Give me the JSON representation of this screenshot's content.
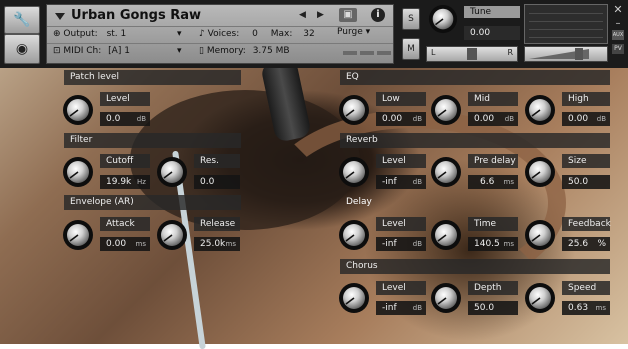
{
  "header": {
    "title": "Urban Gongs Raw",
    "output_label": "Output:",
    "output_value": "st. 1",
    "voices_label": "Voices:",
    "voices_value": "0",
    "max_label": "Max:",
    "max_value": "32",
    "midi_label": "MIDI Ch:",
    "midi_value": "[A]  1",
    "memory_label": "Memory:",
    "memory_value": "3.75 MB",
    "purge_label": "Purge",
    "solo_label": "S",
    "mute_label": "M",
    "tune_label": "Tune",
    "tune_value": "0.00",
    "pan_left": "L",
    "pan_right": "R",
    "aux_label": "AUX",
    "pv_label": "PV"
  },
  "patch_level": {
    "section": "Patch level",
    "label": "Level",
    "value": "0.0",
    "unit": "dB"
  },
  "filter": {
    "section": "Filter",
    "cutoff_label": "Cutoff",
    "cutoff_value": "19.9k",
    "cutoff_unit": "Hz",
    "res_label": "Res.",
    "res_value": "0.0"
  },
  "envelope": {
    "section": "Envelope (AR)",
    "attack_label": "Attack",
    "attack_value": "0.00",
    "attack_unit": "ms",
    "release_label": "Release",
    "release_value": "25.0k",
    "release_unit": "ms"
  },
  "eq": {
    "section": "EQ",
    "low_label": "Low",
    "low_value": "0.00",
    "low_unit": "dB",
    "mid_label": "Mid",
    "mid_value": "0.00",
    "mid_unit": "dB",
    "high_label": "High",
    "high_value": "0.00",
    "high_unit": "dB"
  },
  "reverb": {
    "section": "Reverb",
    "level_label": "Level",
    "level_value": "-inf",
    "level_unit": "dB",
    "predelay_label": "Pre delay",
    "predelay_value": "6.6",
    "predelay_unit": "ms",
    "size_label": "Size",
    "size_value": "50.0"
  },
  "delay": {
    "section": "Delay",
    "level_label": "Level",
    "level_value": "-inf",
    "level_unit": "dB",
    "time_label": "Time",
    "time_value": "140.5",
    "time_unit": "ms",
    "feedback_label": "Feedback",
    "feedback_value": "25.6",
    "feedback_unit": "%"
  },
  "chorus": {
    "section": "Chorus",
    "level_label": "Level",
    "level_value": "-inf",
    "level_unit": "dB",
    "depth_label": "Depth",
    "depth_value": "50.0",
    "speed_label": "Speed",
    "speed_value": "0.63",
    "speed_unit": "ms"
  },
  "icons": [
    "wrench-icon",
    "speaker-icon",
    "camera-icon",
    "info-icon",
    "close-icon"
  ]
}
